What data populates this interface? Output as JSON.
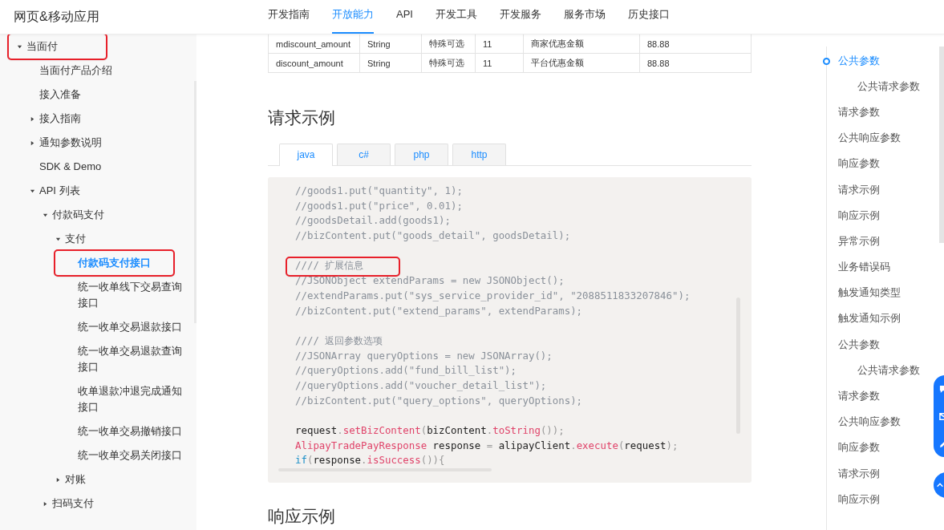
{
  "header": {
    "site_title": "网页&移动应用",
    "nav": [
      {
        "label": "开发指南",
        "selected": false
      },
      {
        "label": "开放能力",
        "selected": true
      },
      {
        "label": "API",
        "selected": false
      },
      {
        "label": "开发工具",
        "selected": false
      },
      {
        "label": "开发服务",
        "selected": false
      },
      {
        "label": "服务市场",
        "selected": false
      },
      {
        "label": "历史接口",
        "selected": false
      }
    ]
  },
  "sidebar": {
    "items": [
      {
        "label": "当面付",
        "expanded": true,
        "selected": false,
        "annotated": true,
        "children": [
          {
            "label": "当面付产品介绍",
            "selected": false,
            "annotated": false
          },
          {
            "label": "接入准备",
            "selected": false,
            "annotated": false
          },
          {
            "label": "接入指南",
            "expanded": false,
            "selected": false,
            "annotated": false
          },
          {
            "label": "通知参数说明",
            "expanded": false,
            "selected": false,
            "annotated": false
          },
          {
            "label": "SDK & Demo",
            "selected": false,
            "annotated": false
          },
          {
            "label": "API 列表",
            "expanded": true,
            "selected": false,
            "annotated": false,
            "children": [
              {
                "label": "付款码支付",
                "expanded": true,
                "selected": false,
                "annotated": false,
                "children": [
                  {
                    "label": "支付",
                    "expanded": true,
                    "selected": false,
                    "annotated": false,
                    "children": [
                      {
                        "label": "付款码支付接口",
                        "selected": true,
                        "annotated": true
                      },
                      {
                        "label": "统一收单线下交易查询接口",
                        "selected": false,
                        "annotated": false
                      },
                      {
                        "label": "统一收单交易退款接口",
                        "selected": false,
                        "annotated": false
                      },
                      {
                        "label": "统一收单交易退款查询接口",
                        "selected": false,
                        "annotated": false
                      },
                      {
                        "label": "收单退款冲退完成通知接口",
                        "selected": false,
                        "annotated": false
                      },
                      {
                        "label": "统一收单交易撤销接口",
                        "selected": false,
                        "annotated": false
                      },
                      {
                        "label": "统一收单交易关闭接口",
                        "selected": false,
                        "annotated": false
                      }
                    ]
                  },
                  {
                    "label": "对账",
                    "expanded": false,
                    "selected": false,
                    "annotated": false
                  }
                ]
              },
              {
                "label": "扫码支付",
                "expanded": false,
                "selected": false,
                "annotated": false
              }
            ]
          }
        ]
      }
    ]
  },
  "table": {
    "rows": [
      [
        "mdiscount_amount",
        "String",
        "特殊可选",
        "11",
        "商家优惠金额",
        "88.88"
      ],
      [
        "discount_amount",
        "String",
        "特殊可选",
        "11",
        "平台优惠金额",
        "88.88"
      ]
    ]
  },
  "request_example": {
    "heading": "请求示例",
    "tabs": [
      {
        "label": "java",
        "selected": true
      },
      {
        "label": "c#",
        "selected": false
      },
      {
        "label": "php",
        "selected": false
      },
      {
        "label": "http",
        "selected": false
      }
    ],
    "code_lines": [
      {
        "annotated": false,
        "segments": [
          {
            "kind": "comment",
            "text": "//goods1.put(\"quantity\", 1);"
          }
        ]
      },
      {
        "annotated": false,
        "segments": [
          {
            "kind": "comment",
            "text": "//goods1.put(\"price\", 0.01);"
          }
        ]
      },
      {
        "annotated": false,
        "segments": [
          {
            "kind": "comment",
            "text": "//goodsDetail.add(goods1);"
          }
        ]
      },
      {
        "annotated": false,
        "segments": [
          {
            "kind": "comment",
            "text": "//bizContent.put(\"goods_detail\", goodsDetail);"
          }
        ]
      },
      {
        "annotated": false
      },
      {
        "annotated": true,
        "segments": [
          {
            "kind": "comment",
            "text": "//// 扩展信息"
          }
        ]
      },
      {
        "annotated": false,
        "segments": [
          {
            "kind": "comment",
            "text": "//JSONObject extendParams = new JSONObject();"
          }
        ]
      },
      {
        "annotated": false,
        "segments": [
          {
            "kind": "comment",
            "text": "//extendParams.put(\"sys_service_provider_id\", \"2088511833207846\");"
          }
        ]
      },
      {
        "annotated": false,
        "segments": [
          {
            "kind": "comment",
            "text": "//bizContent.put(\"extend_params\", extendParams);"
          }
        ]
      },
      {
        "annotated": false
      },
      {
        "annotated": false,
        "segments": [
          {
            "kind": "comment",
            "text": "//// 返回参数选项"
          }
        ]
      },
      {
        "annotated": false,
        "segments": [
          {
            "kind": "comment",
            "text": "//JSONArray queryOptions = new JSONArray();"
          }
        ]
      },
      {
        "annotated": false,
        "segments": [
          {
            "kind": "comment",
            "text": "//queryOptions.add(\"fund_bill_list\");"
          }
        ]
      },
      {
        "annotated": false,
        "segments": [
          {
            "kind": "comment",
            "text": "//queryOptions.add(\"voucher_detail_list\");"
          }
        ]
      },
      {
        "annotated": false,
        "segments": [
          {
            "kind": "comment",
            "text": "//bizContent.put(\"query_options\", queryOptions);"
          }
        ]
      },
      {
        "annotated": false
      },
      {
        "annotated": false,
        "segments": [
          {
            "kind": "plain",
            "text": "request"
          },
          {
            "kind": "punct",
            "text": "."
          },
          {
            "kind": "method",
            "text": "setBizContent"
          },
          {
            "kind": "punct",
            "text": "("
          },
          {
            "kind": "plain",
            "text": "bizContent"
          },
          {
            "kind": "punct",
            "text": "."
          },
          {
            "kind": "method",
            "text": "toString"
          },
          {
            "kind": "punct",
            "text": "());"
          }
        ]
      },
      {
        "annotated": false,
        "segments": [
          {
            "kind": "type",
            "text": "AlipayTradePayResponse"
          },
          {
            "kind": "plain",
            "text": " response "
          },
          {
            "kind": "punct",
            "text": "="
          },
          {
            "kind": "plain",
            "text": " alipayClient"
          },
          {
            "kind": "punct",
            "text": "."
          },
          {
            "kind": "method",
            "text": "execute"
          },
          {
            "kind": "punct",
            "text": "("
          },
          {
            "kind": "plain",
            "text": "request"
          },
          {
            "kind": "punct",
            "text": ");"
          }
        ]
      },
      {
        "annotated": false,
        "segments": [
          {
            "kind": "keyword",
            "text": "if"
          },
          {
            "kind": "punct",
            "text": "("
          },
          {
            "kind": "plain",
            "text": "response"
          },
          {
            "kind": "punct",
            "text": "."
          },
          {
            "kind": "method",
            "text": "isSuccess"
          },
          {
            "kind": "punct",
            "text": "()){"
          }
        ]
      }
    ]
  },
  "response_example": {
    "heading": "响应示例"
  },
  "toc": {
    "items": [
      {
        "label": "公共参数",
        "kind": "top",
        "selected": true
      },
      {
        "label": "公共请求参数",
        "kind": "sub",
        "selected": false
      },
      {
        "label": "请求参数",
        "kind": "top",
        "selected": false
      },
      {
        "label": "公共响应参数",
        "kind": "top",
        "selected": false
      },
      {
        "label": "响应参数",
        "kind": "top",
        "selected": false
      },
      {
        "label": "请求示例",
        "kind": "top",
        "selected": false
      },
      {
        "label": "响应示例",
        "kind": "top",
        "selected": false
      },
      {
        "label": "异常示例",
        "kind": "top",
        "selected": false
      },
      {
        "label": "业务错误码",
        "kind": "top",
        "selected": false
      },
      {
        "label": "触发通知类型",
        "kind": "top",
        "selected": false
      },
      {
        "label": "触发通知示例",
        "kind": "top",
        "selected": false
      },
      {
        "label": "公共参数",
        "kind": "top",
        "selected": false
      },
      {
        "label": "公共请求参数",
        "kind": "sub",
        "selected": false
      },
      {
        "label": "请求参数",
        "kind": "top",
        "selected": false
      },
      {
        "label": "公共响应参数",
        "kind": "top",
        "selected": false
      },
      {
        "label": "响应参数",
        "kind": "top",
        "selected": false
      },
      {
        "label": "请求示例",
        "kind": "top",
        "selected": false
      },
      {
        "label": "响应示例",
        "kind": "top",
        "selected": false
      }
    ]
  }
}
